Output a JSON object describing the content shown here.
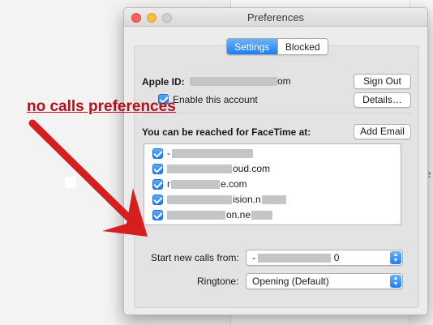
{
  "window": {
    "title": "Preferences"
  },
  "tabs": [
    {
      "label": "Settings",
      "active": true
    },
    {
      "label": "Blocked",
      "active": false
    }
  ],
  "account": {
    "apple_id_label": "Apple ID:",
    "apple_id_suffix": "om",
    "sign_out_label": "Sign Out",
    "enable_label": "Enable this account",
    "enable_checked": true,
    "details_label": "Details…"
  },
  "reach": {
    "heading": "You can be reached for FaceTime at:",
    "add_email_label": "Add Email",
    "addresses": [
      {
        "visible_text": "-",
        "checked": true
      },
      {
        "visible_text": "oud.com",
        "checked": true
      },
      {
        "visible_text": "r",
        "visible_text_2": "e.com",
        "checked": true
      },
      {
        "visible_text": "ision.n",
        "checked": true
      },
      {
        "visible_text": "on.ne",
        "checked": true
      }
    ]
  },
  "calls": {
    "start_label": "Start new calls from:",
    "start_value_prefix": "-",
    "start_value_suffix": "0",
    "ringtone_label": "Ringtone:",
    "ringtone_value": "Opening (Default)"
  },
  "annotation": {
    "text": "no calls preferences",
    "color": "#b3111a"
  },
  "colors": {
    "accent": "#1b7ff5"
  }
}
